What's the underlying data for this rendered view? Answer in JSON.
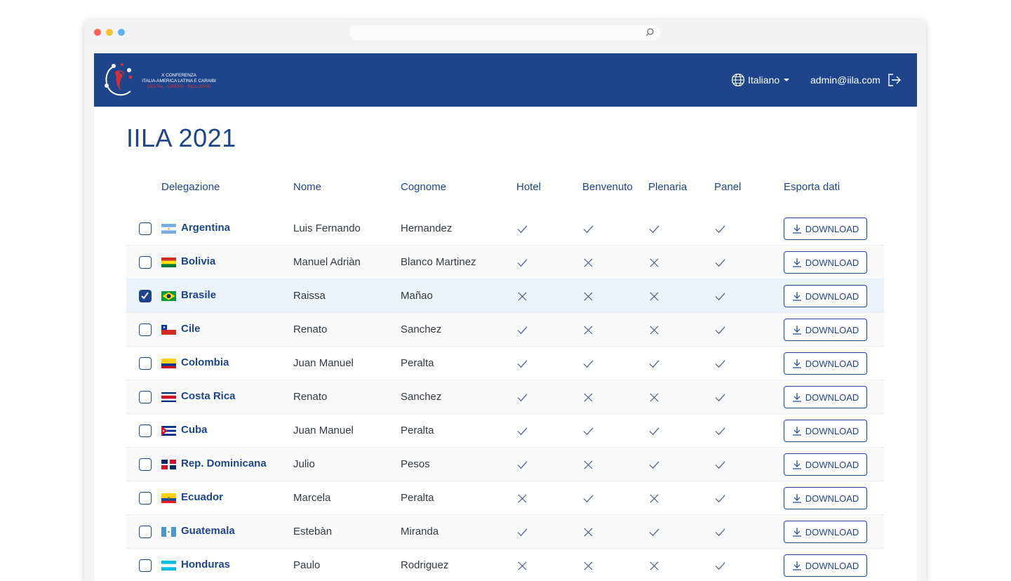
{
  "logo": {
    "line1": "X CONFERENZA",
    "line2": "ITALIA-AMERICA LATINA E CARAIBI",
    "line3": "DIGITAL · GREEN · INCLUSIVE"
  },
  "header": {
    "language": "Italiano",
    "user_email": "admin@iila.com"
  },
  "page": {
    "title": "IILA 2021"
  },
  "table": {
    "columns": {
      "delegation": "Delegazione",
      "name": "Nome",
      "surname": "Cognome",
      "hotel": "Hotel",
      "welcome": "Benvenuto",
      "plenary": "Plenaria",
      "panel": "Panel",
      "export": "Esporta dati"
    },
    "download_label": "DOWNLOAD",
    "rows": [
      {
        "country": "Argentina",
        "flag": "argentina",
        "name": "Luis Fernando",
        "surname": "Hernandez",
        "selected": false,
        "hotel": true,
        "welcome": true,
        "plenary": true,
        "panel": true
      },
      {
        "country": "Bolivia",
        "flag": "bolivia",
        "name": "Manuel Adriàn",
        "surname": "Blanco Martinez",
        "selected": false,
        "hotel": true,
        "welcome": false,
        "plenary": false,
        "panel": true
      },
      {
        "country": "Brasile",
        "flag": "brazil",
        "name": "Raissa",
        "surname": "Mañao",
        "selected": true,
        "hotel": false,
        "welcome": false,
        "plenary": false,
        "panel": true
      },
      {
        "country": "Cile",
        "flag": "chile",
        "name": "Renato",
        "surname": "Sanchez",
        "selected": false,
        "hotel": true,
        "welcome": false,
        "plenary": false,
        "panel": true
      },
      {
        "country": "Colombia",
        "flag": "colombia",
        "name": "Juan Manuel",
        "surname": "Peralta",
        "selected": false,
        "hotel": true,
        "welcome": true,
        "plenary": true,
        "panel": true
      },
      {
        "country": "Costa Rica",
        "flag": "costa-rica",
        "name": "Renato",
        "surname": "Sanchez",
        "selected": false,
        "hotel": true,
        "welcome": false,
        "plenary": false,
        "panel": true
      },
      {
        "country": "Cuba",
        "flag": "cuba",
        "name": "Juan Manuel",
        "surname": "Peralta",
        "selected": false,
        "hotel": true,
        "welcome": true,
        "plenary": true,
        "panel": true
      },
      {
        "country": "Rep. Dominicana",
        "flag": "dominican-republic",
        "name": "Julio",
        "surname": "Pesos",
        "selected": false,
        "hotel": true,
        "welcome": false,
        "plenary": true,
        "panel": true
      },
      {
        "country": "Ecuador",
        "flag": "ecuador",
        "name": "Marcela",
        "surname": "Peralta",
        "selected": false,
        "hotel": false,
        "welcome": true,
        "plenary": false,
        "panel": true
      },
      {
        "country": "Guatemala",
        "flag": "guatemala",
        "name": "Estebàn",
        "surname": "Miranda",
        "selected": false,
        "hotel": true,
        "welcome": false,
        "plenary": true,
        "panel": true
      },
      {
        "country": "Honduras",
        "flag": "honduras",
        "name": "Paulo",
        "surname": "Rodriguez",
        "selected": false,
        "hotel": false,
        "welcome": false,
        "plenary": false,
        "panel": true
      }
    ]
  },
  "colors": {
    "primary": "#1e458c",
    "text": "#333a44",
    "selected_row": "#eaf3f9"
  },
  "icons": {
    "language": "globe-icon",
    "logout": "logout-icon",
    "check": "check-icon",
    "cross": "cross-icon",
    "download": "download-icon",
    "search": "search-icon"
  }
}
